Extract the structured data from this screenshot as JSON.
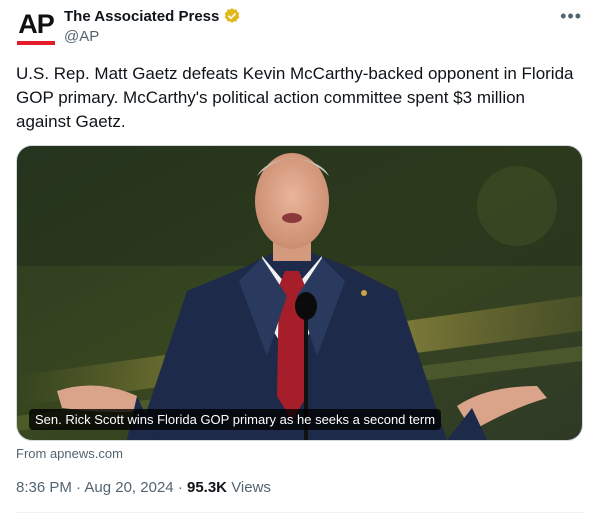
{
  "author": {
    "display_name": "The Associated Press",
    "handle": "@AP",
    "avatar_text": "AP",
    "verified": true,
    "verified_color": "#e2b719"
  },
  "menu": {
    "more_icon": "more-horizontal-icon"
  },
  "tweet": {
    "text": "U.S. Rep. Matt Gaetz defeats Kevin McCarthy-backed opponent in Florida GOP primary. McCarthy's political action committee spent $3 million against Gaetz."
  },
  "card": {
    "caption": "Sen. Rick Scott wins Florida GOP primary as he seeks a second term",
    "source": "From apnews.com"
  },
  "meta": {
    "time": "8:36 PM",
    "separator": "·",
    "date": "Aug 20, 2024",
    "views_count": "95.3K",
    "views_label": "Views"
  },
  "colors": {
    "accent_red": "#e21c29",
    "muted_text": "#536471",
    "primary_text": "#0f1419"
  }
}
